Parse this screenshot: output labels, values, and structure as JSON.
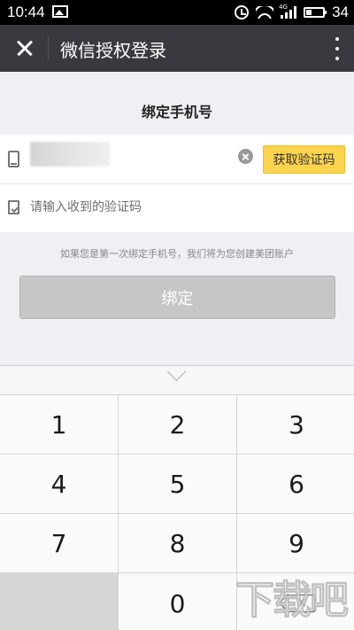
{
  "status_bar": {
    "time": "10:44",
    "battery": "34",
    "signal_label": "4G"
  },
  "app_bar": {
    "title": "微信授权登录"
  },
  "page": {
    "title": "绑定手机号"
  },
  "form": {
    "phone_value": "",
    "get_code_label": "获取验证码",
    "code_placeholder": "请输入收到的验证码",
    "code_value": ""
  },
  "hint": "如果您是第一次绑定手机号，我们将为您创建美团账户",
  "bind_button_label": "绑定",
  "keypad": {
    "keys": [
      "1",
      "2",
      "3",
      "4",
      "5",
      "6",
      "7",
      "8",
      "9",
      "0"
    ]
  },
  "watermark": "下载吧",
  "colors": {
    "header": "#393a3f",
    "accent": "#fcd34d",
    "disabled_button": "#c6c6c6"
  },
  "icons": [
    "image-icon",
    "alarm-icon",
    "wifi-icon",
    "signal-icon",
    "battery-icon",
    "close-icon",
    "more-icon",
    "phone-icon",
    "clear-icon",
    "code-icon",
    "chevron-down-icon",
    "backspace-icon"
  ]
}
